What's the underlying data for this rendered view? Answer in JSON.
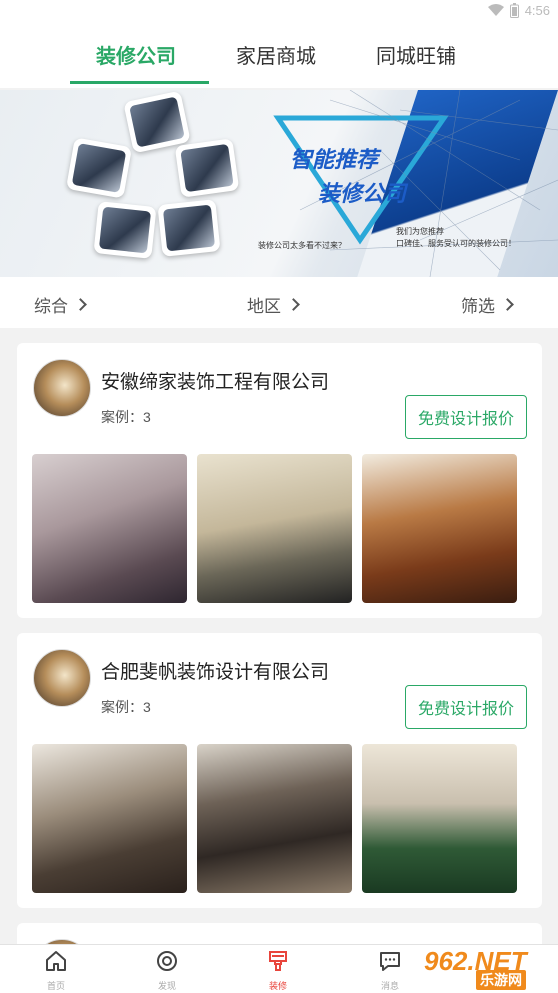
{
  "status_bar": {
    "time": "4:56"
  },
  "tabs": [
    {
      "label": "装修公司",
      "active": true
    },
    {
      "label": "家居商城",
      "active": false
    },
    {
      "label": "同城旺铺",
      "active": false
    }
  ],
  "banner": {
    "title_line1": "智能推荐",
    "title_line2": "装修公司",
    "note_left": "装修公司太多看不过来？",
    "note_right1": "我们为您推荐",
    "note_right2": "口碑佳、服务受认可的装修公司！"
  },
  "filters": [
    {
      "label": "综合"
    },
    {
      "label": "地区"
    },
    {
      "label": "筛选"
    }
  ],
  "companies": [
    {
      "name": "安徽缔家装饰工程有限公司",
      "cases": "案例：3",
      "quote_button": "免费设计报价"
    },
    {
      "name": "合肥斐帆装饰设计有限公司",
      "cases": "案例：3",
      "quote_button": "免费设计报价"
    }
  ],
  "bottom_nav": [
    {
      "label": "首页",
      "icon": "home-icon",
      "active": false
    },
    {
      "label": "发现",
      "icon": "discover-icon",
      "active": false
    },
    {
      "label": "装修",
      "icon": "brush-icon",
      "active": true
    },
    {
      "label": "消息",
      "icon": "message-icon",
      "active": false
    }
  ],
  "watermark": {
    "line1": "962.NET",
    "line2": "乐游网"
  },
  "colors": {
    "accent": "#2aa866",
    "nav_active": "#e8453c",
    "banner_blue": "#1c5cc7",
    "watermark": "#f08a1c"
  }
}
